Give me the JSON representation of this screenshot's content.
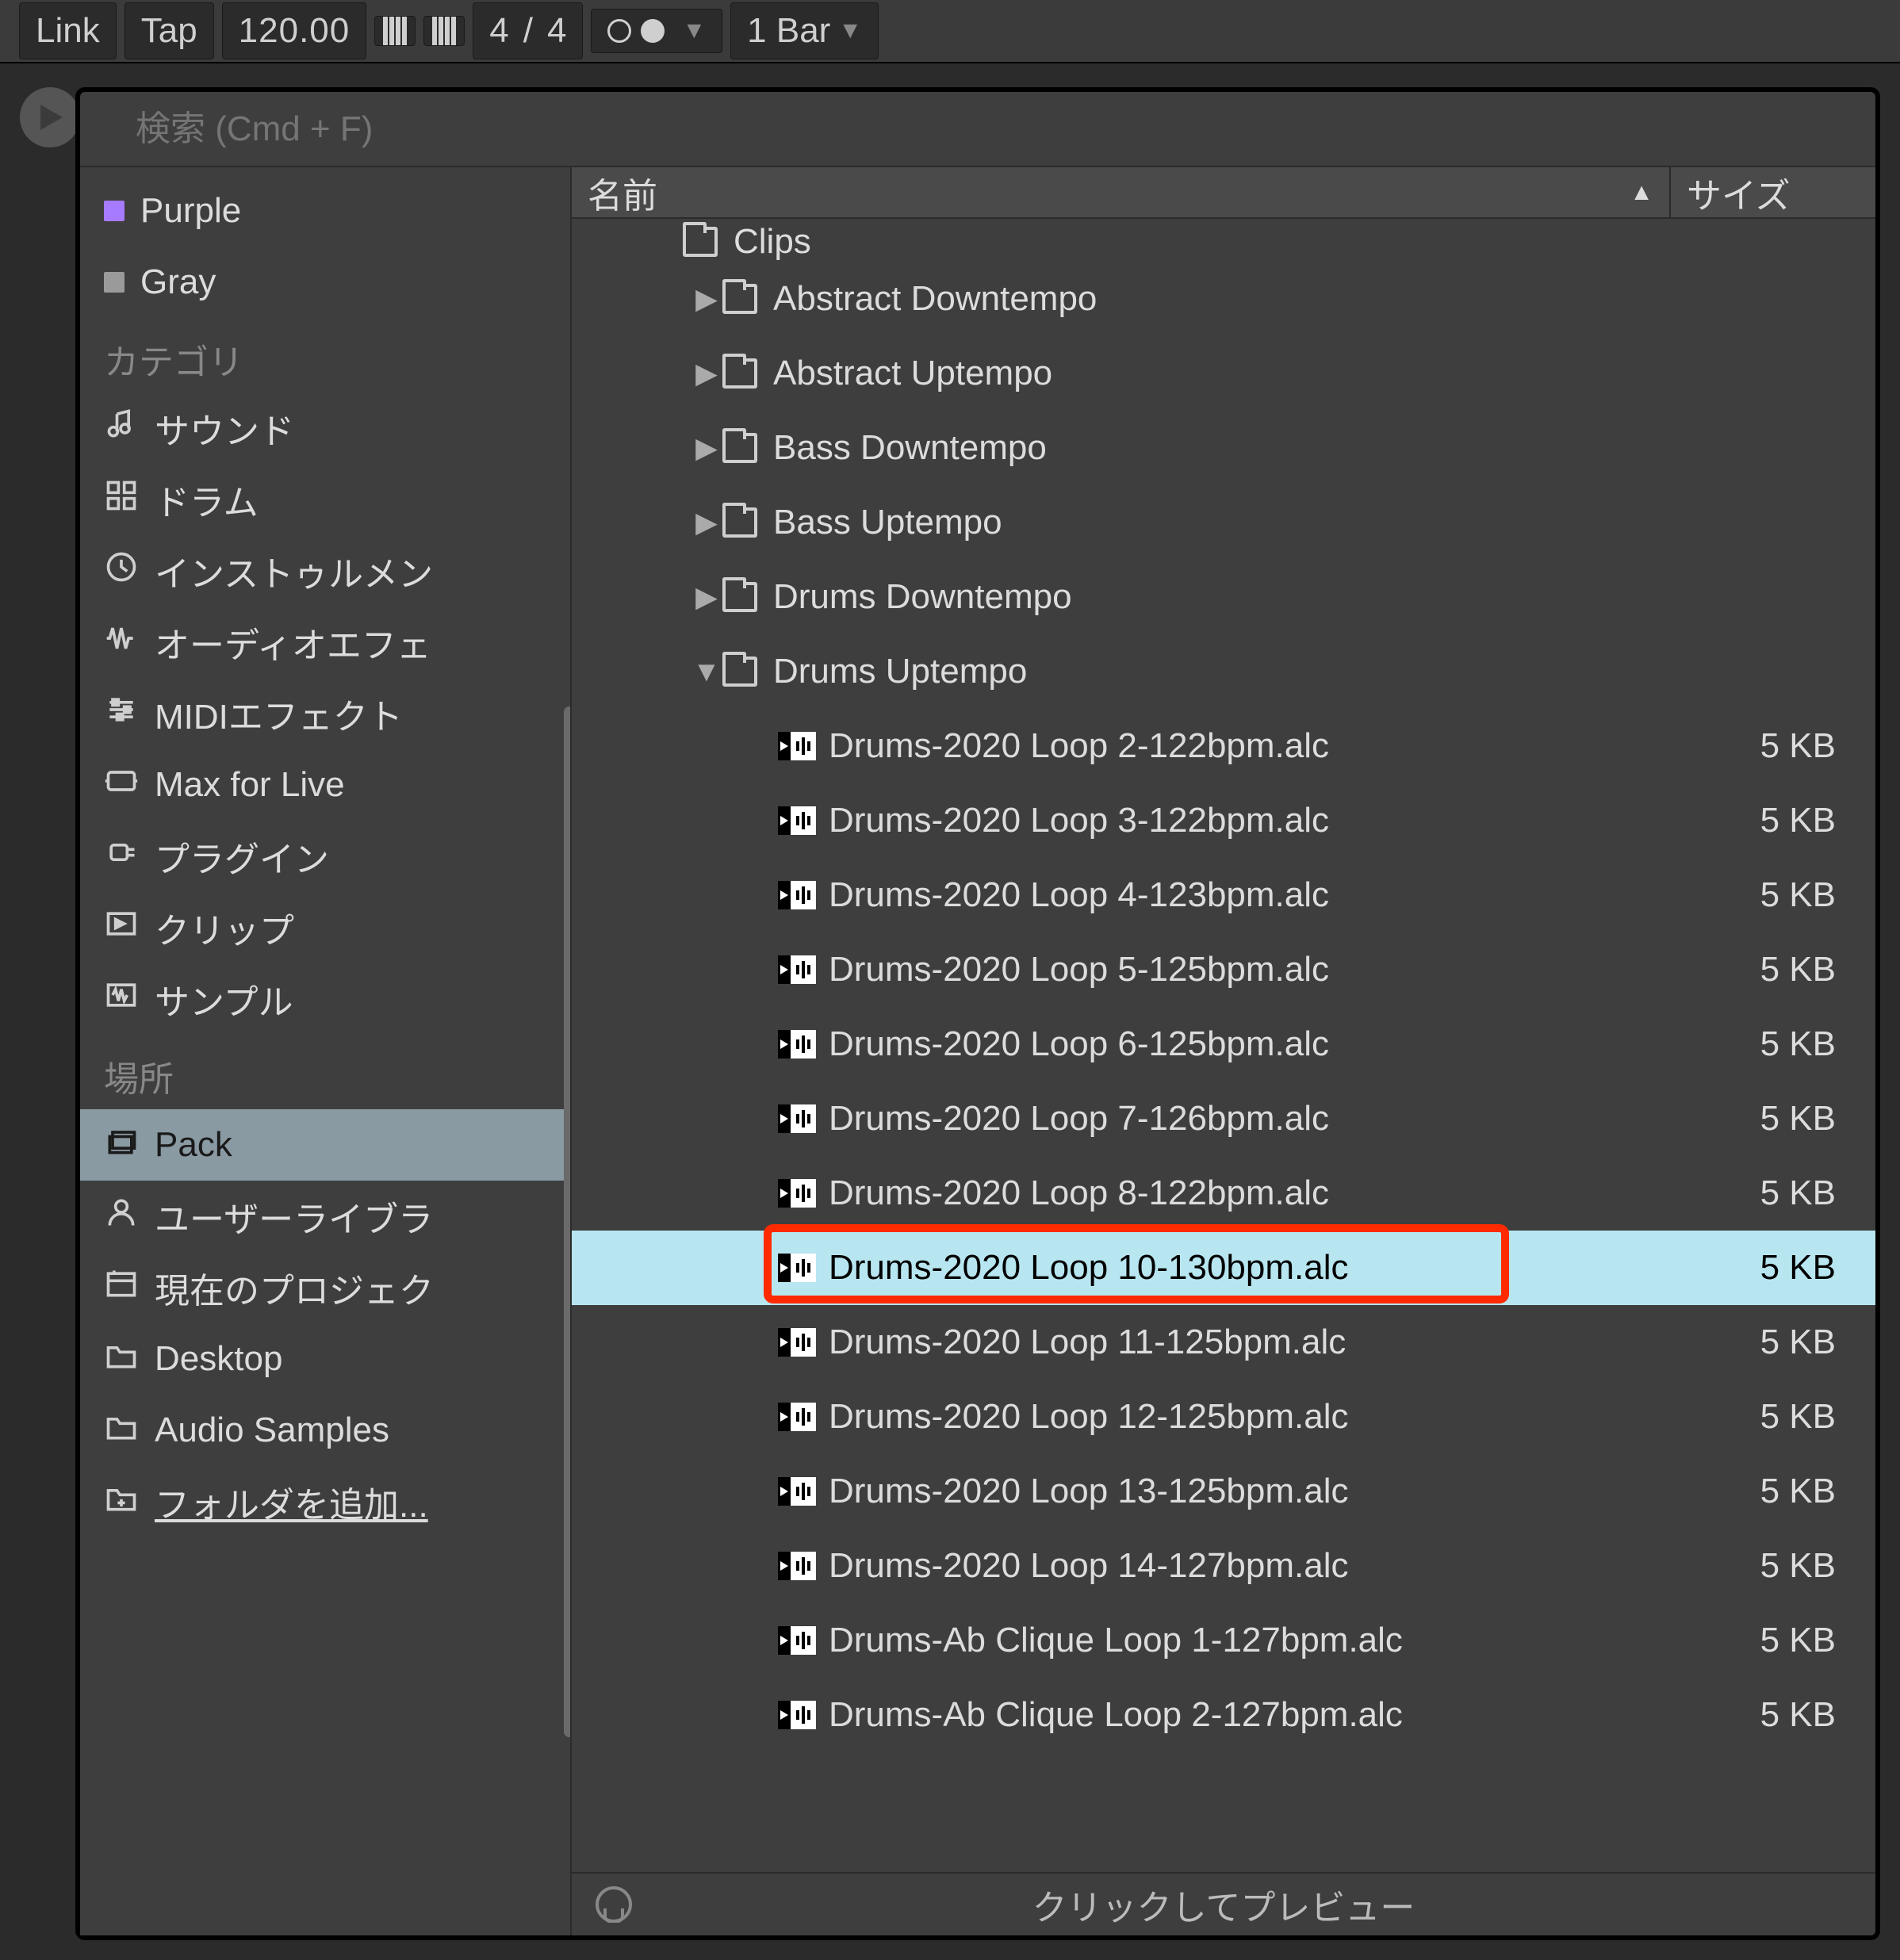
{
  "topbar": {
    "link": "Link",
    "tap": "Tap",
    "tempo": "120.00",
    "sig_num": "4",
    "sig_den": "4",
    "quantize": "1 Bar"
  },
  "search": {
    "placeholder": "検索 (Cmd + F)"
  },
  "filters": [
    {
      "label": "Purple",
      "color": "#a77bff"
    },
    {
      "label": "Gray",
      "color": "#9a9a9a"
    }
  ],
  "sections": {
    "categories_title": "カテゴリ",
    "places_title": "場所"
  },
  "categories": [
    {
      "label": "サウンド",
      "icon": "note"
    },
    {
      "label": "ドラム",
      "icon": "pads"
    },
    {
      "label": "インストゥルメン",
      "icon": "clock"
    },
    {
      "label": "オーディオエフェ",
      "icon": "wave"
    },
    {
      "label": "MIDIエフェクト",
      "icon": "sliders"
    },
    {
      "label": "Max for Live",
      "icon": "max"
    },
    {
      "label": "プラグイン",
      "icon": "plug"
    },
    {
      "label": "クリップ",
      "icon": "clip"
    },
    {
      "label": "サンプル",
      "icon": "sample"
    }
  ],
  "places": [
    {
      "label": "Pack",
      "icon": "stack",
      "selected": true
    },
    {
      "label": "ユーザーライブラ",
      "icon": "user"
    },
    {
      "label": "現在のプロジェク",
      "icon": "project"
    },
    {
      "label": "Desktop",
      "icon": "folder"
    },
    {
      "label": "Audio Samples",
      "icon": "folder"
    },
    {
      "label": "フォルダを追加...",
      "icon": "addfolder",
      "underline": true
    }
  ],
  "list_header": {
    "name": "名前",
    "size": "サイズ",
    "sort_dir": "▲"
  },
  "tree": {
    "top_cut": "Clips",
    "folders": [
      {
        "name": "Abstract Downtempo",
        "expanded": false
      },
      {
        "name": "Abstract Uptempo",
        "expanded": false
      },
      {
        "name": "Bass Downtempo",
        "expanded": false
      },
      {
        "name": "Bass Uptempo",
        "expanded": false
      },
      {
        "name": "Drums Downtempo",
        "expanded": false
      },
      {
        "name": "Drums Uptempo",
        "expanded": true
      }
    ],
    "files": [
      {
        "name": "Drums-2020 Loop 2-122bpm.alc",
        "size": "5 KB"
      },
      {
        "name": "Drums-2020 Loop 3-122bpm.alc",
        "size": "5 KB"
      },
      {
        "name": "Drums-2020 Loop 4-123bpm.alc",
        "size": "5 KB"
      },
      {
        "name": "Drums-2020 Loop 5-125bpm.alc",
        "size": "5 KB"
      },
      {
        "name": "Drums-2020 Loop 6-125bpm.alc",
        "size": "5 KB"
      },
      {
        "name": "Drums-2020 Loop 7-126bpm.alc",
        "size": "5 KB"
      },
      {
        "name": "Drums-2020 Loop 8-122bpm.alc",
        "size": "5 KB"
      },
      {
        "name": "Drums-2020 Loop 10-130bpm.alc",
        "size": "5 KB",
        "selected": true,
        "highlight": true
      },
      {
        "name": "Drums-2020 Loop 11-125bpm.alc",
        "size": "5 KB"
      },
      {
        "name": "Drums-2020 Loop 12-125bpm.alc",
        "size": "5 KB"
      },
      {
        "name": "Drums-2020 Loop 13-125bpm.alc",
        "size": "5 KB"
      },
      {
        "name": "Drums-2020 Loop 14-127bpm.alc",
        "size": "5 KB"
      },
      {
        "name": "Drums-Ab Clique Loop 1-127bpm.alc",
        "size": "5 KB"
      },
      {
        "name": "Drums-Ab Clique Loop 2-127bpm.alc",
        "size": "5 KB"
      }
    ]
  },
  "footer": {
    "preview": "クリックしてプレビュー"
  },
  "colors": {
    "highlight_border": "#ff2a00",
    "selection_bg": "#b8e6f0"
  }
}
